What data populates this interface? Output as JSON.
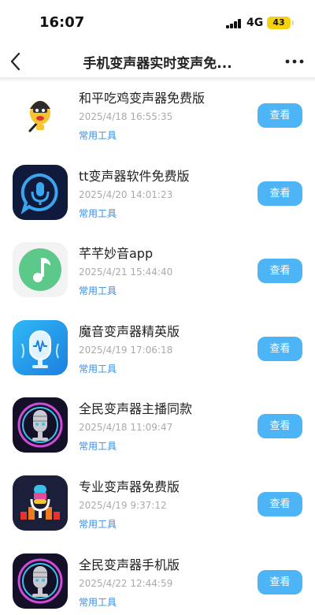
{
  "status_bar": {
    "time": "16:07",
    "network": "4G",
    "battery": "43"
  },
  "nav": {
    "title": "手机变声器实时变声免...",
    "back_icon": "chevron-left-icon",
    "more_icon": "more-dots-icon"
  },
  "colors": {
    "accent": "#4db4f6",
    "category": "#3a8ee6",
    "date": "#aaaaaa"
  },
  "apps": [
    {
      "name": "和平吃鸡变声器免费版",
      "date": "2025/4/18 16:55:35",
      "category": "常用工具",
      "button": "查看",
      "icon": "cartoon-microphone-icon"
    },
    {
      "name": "tt变声器软件免费版",
      "date": "2025/4/20 14:01:23",
      "category": "常用工具",
      "button": "查看",
      "icon": "microphone-chat-icon"
    },
    {
      "name": "芊芊妙音app",
      "date": "2025/4/21 15:44:40",
      "category": "常用工具",
      "button": "查看",
      "icon": "music-note-icon"
    },
    {
      "name": "魔音变声器精英版",
      "date": "2025/4/19 17:06:18",
      "category": "常用工具",
      "button": "查看",
      "icon": "waveform-microphone-icon"
    },
    {
      "name": "全民变声器主播同款",
      "date": "2025/4/18 11:09:47",
      "category": "常用工具",
      "button": "查看",
      "icon": "robot-microphone-icon"
    },
    {
      "name": "专业变声器免费版",
      "date": "2025/4/19 9:37:12",
      "category": "常用工具",
      "button": "查看",
      "icon": "equalizer-microphone-icon"
    },
    {
      "name": "全民变声器手机版",
      "date": "2025/4/22 12:44:59",
      "category": "常用工具",
      "button": "查看",
      "icon": "robot-microphone-icon"
    }
  ]
}
